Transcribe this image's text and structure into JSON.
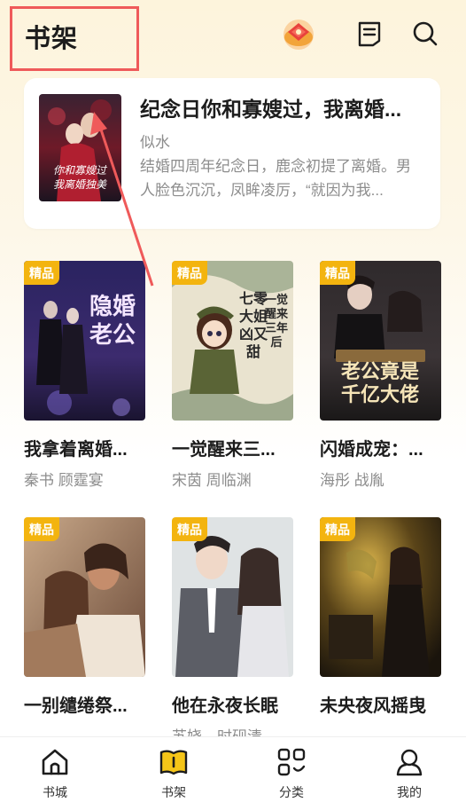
{
  "header": {
    "title": "书架"
  },
  "featured": {
    "title": "纪念日你和寡嫂过，我离婚...",
    "author": "似水",
    "description": "结婚四周年纪念日，鹿念初提了离婚。男人脸色沉沉，凤眸凌厉，“就因为我...",
    "cover_text": "纪念日你和寡嫂过我离婚独美"
  },
  "books": [
    {
      "badge": "精品",
      "title": "我拿着离婚...",
      "authors": "秦书  顾霆宴",
      "cover_text": "隐婚老公"
    },
    {
      "badge": "精品",
      "title": "一觉醒来三...",
      "authors": "宋茵  周临渊",
      "cover_text": "一觉醒来三年后"
    },
    {
      "badge": "精品",
      "title": "闪婚成宠：...",
      "authors": "海彤  战胤",
      "cover_text": "老公竟是千亿大佬"
    },
    {
      "badge": "精品",
      "title": "一别缱绻祭...",
      "authors": "",
      "cover_text": ""
    },
    {
      "badge": "精品",
      "title": "他在永夜长眠",
      "authors": "苏娆、时砚清",
      "cover_text": ""
    },
    {
      "badge": "精品",
      "title": "未央夜风摇曳",
      "authors": "",
      "cover_text": ""
    }
  ],
  "nav": [
    {
      "label": "书城",
      "icon": "home-icon"
    },
    {
      "label": "书架",
      "icon": "bookshelf-icon",
      "active": true
    },
    {
      "label": "分类",
      "icon": "category-icon"
    },
    {
      "label": "我的",
      "icon": "profile-icon"
    }
  ],
  "colors": {
    "badge": "#f3b40f",
    "annotation": "#ef5a5a",
    "nav_active": "#f5c518"
  }
}
